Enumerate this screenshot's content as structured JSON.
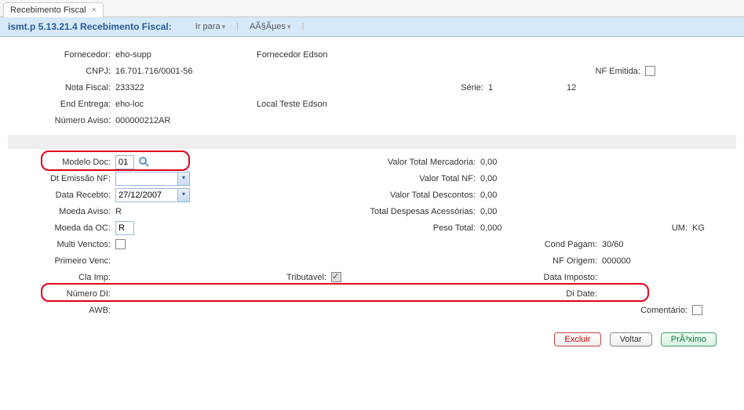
{
  "tab": {
    "title": "Recebimento Fiscal",
    "close": "×"
  },
  "header": {
    "title": "ismt.p 5.13.21.4 Recebimento Fiscal:",
    "menu1": "Ir para",
    "menu2": "AÃ§Ãµes"
  },
  "top": {
    "fornecedor_label": "Fornecedor:",
    "fornecedor_value": "eho-supp",
    "fornecedor_name": "Fornecedor Edson",
    "cnpj_label": "CNPJ:",
    "cnpj_value": "16.701.716/0001-56",
    "nf_emitida_label": "NF Emitida:",
    "nota_fiscal_label": "Nota Fiscal:",
    "nota_fiscal_value": "233322",
    "serie_label": "Série:",
    "serie_value": "1",
    "serie_extra": "12",
    "end_entrega_label": "End Entrega:",
    "end_entrega_value": "eho-loc",
    "end_entrega_name": "Local Teste Edson",
    "numero_aviso_label": "Número Aviso:",
    "numero_aviso_value": "000000212AR"
  },
  "left": {
    "modelo_doc_label": "Modelo Doc:",
    "modelo_doc_value": "01",
    "dt_emissao_label": "Dt Emissão NF:",
    "dt_emissao_value": "",
    "data_recebto_label": "Data Recebto:",
    "data_recebto_value": "27/12/2007",
    "moeda_aviso_label": "Moeda Aviso:",
    "moeda_aviso_value": "R",
    "moeda_oc_label": "Moeda da OC:",
    "moeda_oc_value": "R",
    "multi_venctos_label": "Multi Venctos:",
    "primeiro_venc_label": "Primeiro Venc:",
    "cla_imp_label": "Cla Imp:",
    "numero_di_label": "Número DI:",
    "awb_label": "AWB:"
  },
  "mid": {
    "valor_total_merc_label": "Valor Total Mercadoria:",
    "valor_total_merc_value": "0,00",
    "valor_total_nf_label": "Valor Total NF:",
    "valor_total_nf_value": "0,00",
    "valor_total_desc_label": "Valor Total Descontos:",
    "valor_total_desc_value": "0,00",
    "total_desp_label": "Total Despesas Acessórias:",
    "total_desp_value": "0,00",
    "peso_label": "Peso Total:",
    "peso_value": "0,000",
    "tributavel_label": "Tributavel:"
  },
  "right": {
    "um_label": "UM:",
    "um_value": "KG",
    "cond_pagam_label": "Cond Pagam:",
    "cond_pagam_value": "30/60",
    "nf_origem_label": "NF Origem:",
    "nf_origem_value": "000000",
    "data_imposto_label": "Data Imposto:",
    "di_date_label": "Di Date:",
    "comentario_label": "Comentário:"
  },
  "buttons": {
    "excluir": "Excluir",
    "voltar": "Voltar",
    "proximo": "PrÃ³ximo"
  }
}
